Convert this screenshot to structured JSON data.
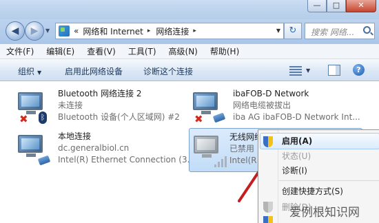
{
  "caption_buttons": {
    "minimize": "—",
    "maximize": "□",
    "close": "✕"
  },
  "address": {
    "overflow": "«",
    "crumbs": [
      "网络和 Internet",
      "网络连接"
    ],
    "separator": "▸",
    "search_placeholder": "搜索 网络..."
  },
  "menubar": [
    "文件(F)",
    "编辑(E)",
    "查看(V)",
    "工具(T)",
    "高级(N)",
    "帮助(H)"
  ],
  "toolbar": {
    "organize": "组织",
    "enable": "启用此网络设备",
    "diagnose": "诊断这个连接",
    "help": "?"
  },
  "connections": [
    {
      "name": "Bluetooth 网络连接 2",
      "status": "未连接",
      "device": "Bluetooth 设备(个人区域网) #2",
      "icon": "bluetooth-adapter-icon"
    },
    {
      "name": "ibaFOB-D Network",
      "status": "网络电缆被拔出",
      "device": "iba AG ibaFOB-D Network Int...",
      "icon": "ethernet-adapter-icon"
    },
    {
      "name": "本地连接",
      "status": "dc.generalbiol.cn",
      "device": "Intel(R) Ethernet Connection (3...",
      "icon": "ethernet-adapter-icon"
    },
    {
      "name": "无线网络",
      "status": "已禁用",
      "device": "Intel(R",
      "icon": "wireless-adapter-icon"
    }
  ],
  "context_menu": {
    "items": [
      {
        "label": "启用(A)",
        "style": "bold"
      },
      {
        "label": "状态(U)",
        "style": "disabled"
      },
      {
        "label": "诊断(I)",
        "style": "normal"
      },
      {
        "label": "创建快捷方式(S)",
        "style": "normal"
      },
      {
        "label": "删除(D)",
        "style": "disabled"
      }
    ]
  },
  "watermark": "爱例根知识网",
  "colors": {
    "accent": "#2d6bb3",
    "arrow": "#c41e1e",
    "selection": "#c1dcf7"
  }
}
